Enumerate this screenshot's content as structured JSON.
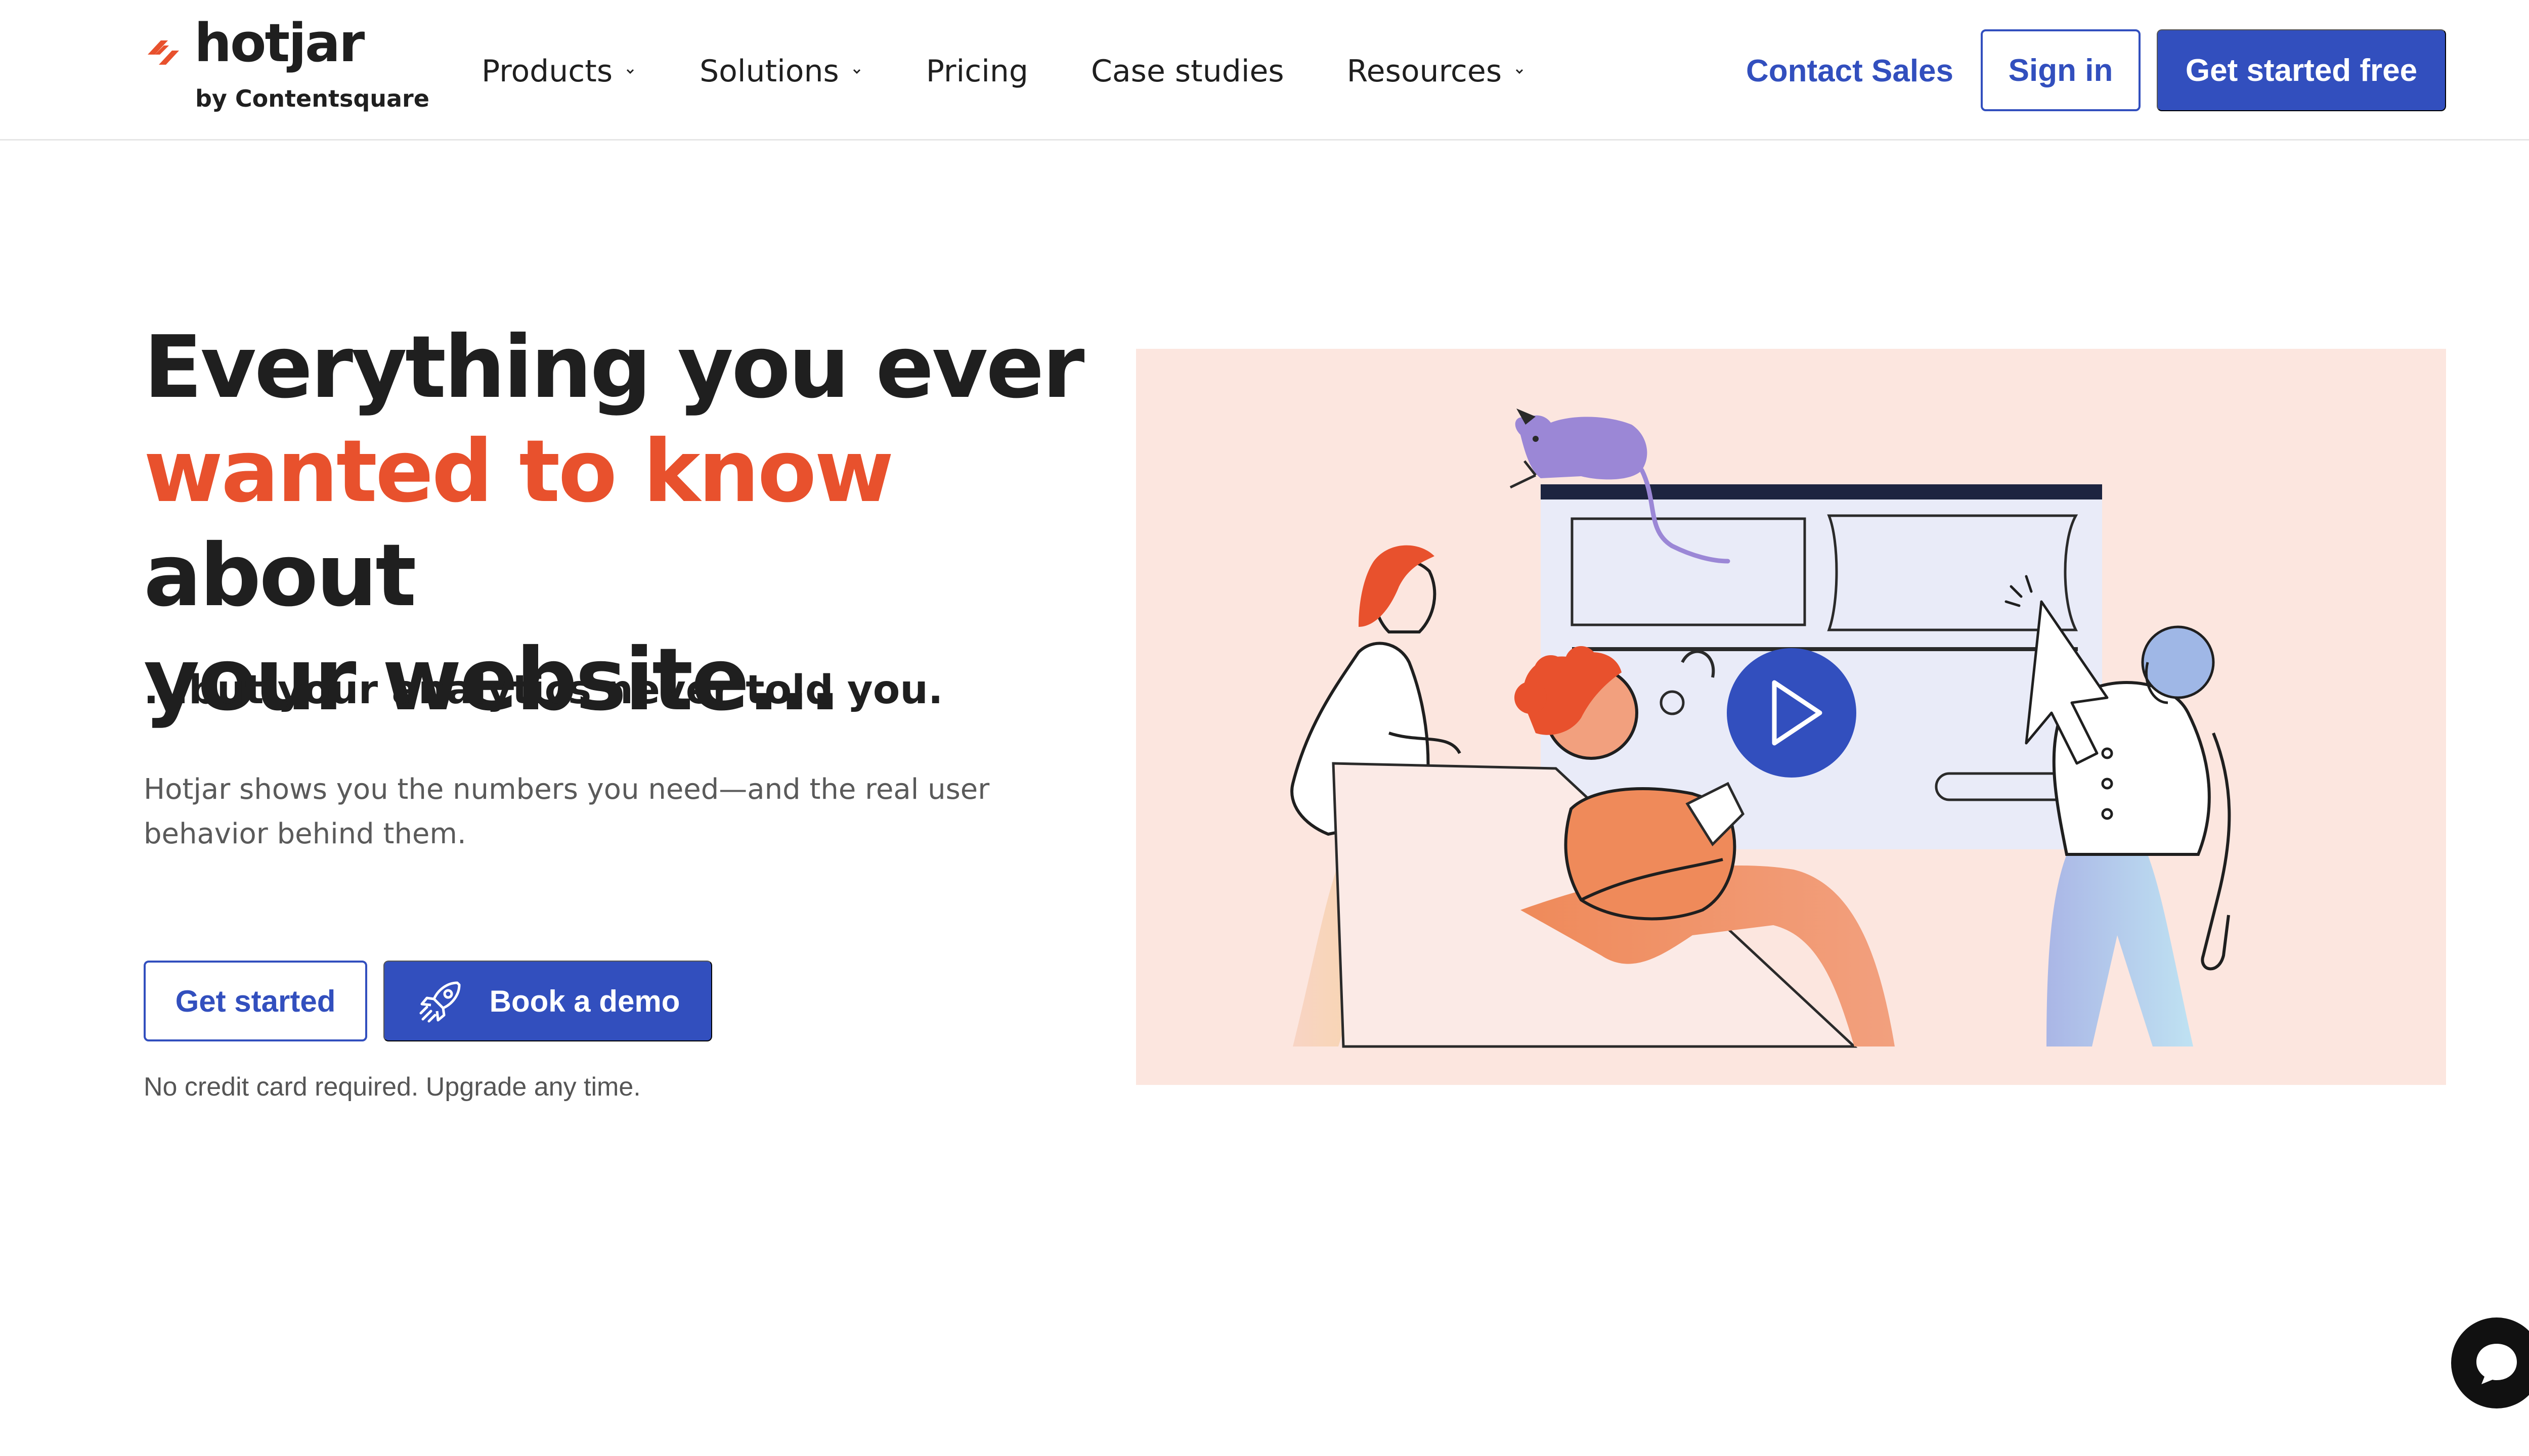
{
  "brand": {
    "name": "hotjar",
    "tagline": "by Contentsquare",
    "mark_color": "#e8512d"
  },
  "nav": {
    "items": [
      {
        "label": "Products",
        "has_dropdown": true
      },
      {
        "label": "Solutions",
        "has_dropdown": true
      },
      {
        "label": "Pricing",
        "has_dropdown": false
      },
      {
        "label": "Case studies",
        "has_dropdown": false
      },
      {
        "label": "Resources",
        "has_dropdown": true
      }
    ],
    "contact_label": "Contact Sales",
    "signin_label": "Sign in",
    "get_started_free_label": "Get started free"
  },
  "hero": {
    "title_line1": "Everything you ever",
    "title_accent": "wanted to know",
    "title_after_accent": " about",
    "title_line3": "your website...",
    "subtitle": "...but your analytics never told you.",
    "description": "Hotjar shows you the numbers you need—and the real user behavior behind them.",
    "get_started_label": "Get started",
    "book_demo_label": "Book a demo",
    "note": "No credit card required. Upgrade any time."
  },
  "media": {
    "kind": "video",
    "play_icon": "play-icon"
  },
  "colors": {
    "primary": "#324fbe",
    "accent": "#e8512d",
    "text": "#1f1f1f",
    "muted": "#5a5a5a",
    "media_bg": "#fce6df"
  }
}
